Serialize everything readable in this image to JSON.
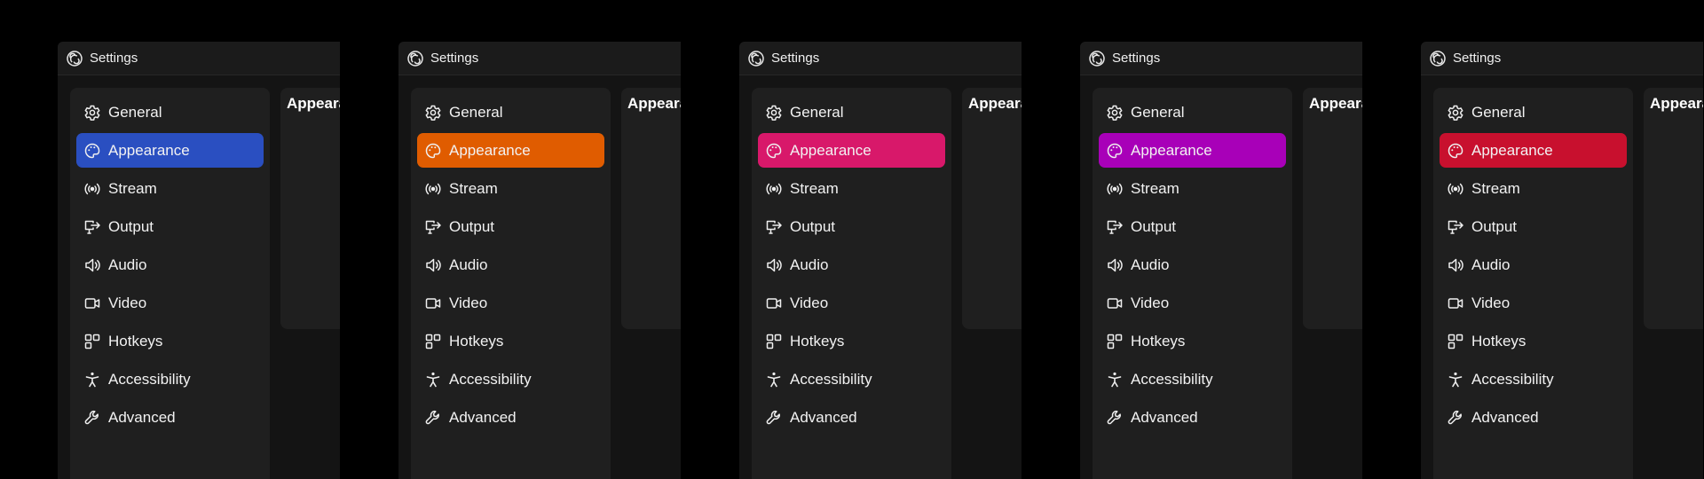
{
  "windows": [
    {
      "title": "Settings",
      "accent": "#2a4fc1",
      "nav": [
        {
          "label": "General",
          "icon": "gear-icon"
        },
        {
          "label": "Appearance",
          "icon": "palette-icon",
          "active": true
        },
        {
          "label": "Stream",
          "icon": "broadcast-icon"
        },
        {
          "label": "Output",
          "icon": "output-icon"
        },
        {
          "label": "Audio",
          "icon": "speaker-icon"
        },
        {
          "label": "Video",
          "icon": "video-camera-icon"
        },
        {
          "label": "Hotkeys",
          "icon": "hotkeys-icon"
        },
        {
          "label": "Accessibility",
          "icon": "accessibility-icon"
        },
        {
          "label": "Advanced",
          "icon": "wrench-icon"
        }
      ],
      "panel_title": "Appearance"
    },
    {
      "title": "Settings",
      "accent": "#e05c00",
      "nav": [
        {
          "label": "General",
          "icon": "gear-icon"
        },
        {
          "label": "Appearance",
          "icon": "palette-icon",
          "active": true
        },
        {
          "label": "Stream",
          "icon": "broadcast-icon"
        },
        {
          "label": "Output",
          "icon": "output-icon"
        },
        {
          "label": "Audio",
          "icon": "speaker-icon"
        },
        {
          "label": "Video",
          "icon": "video-camera-icon"
        },
        {
          "label": "Hotkeys",
          "icon": "hotkeys-icon"
        },
        {
          "label": "Accessibility",
          "icon": "accessibility-icon"
        },
        {
          "label": "Advanced",
          "icon": "wrench-icon"
        }
      ],
      "panel_title": "Appearance"
    },
    {
      "title": "Settings",
      "accent": "#d8186a",
      "nav": [
        {
          "label": "General",
          "icon": "gear-icon"
        },
        {
          "label": "Appearance",
          "icon": "palette-icon",
          "active": true
        },
        {
          "label": "Stream",
          "icon": "broadcast-icon"
        },
        {
          "label": "Output",
          "icon": "output-icon"
        },
        {
          "label": "Audio",
          "icon": "speaker-icon"
        },
        {
          "label": "Video",
          "icon": "video-camera-icon"
        },
        {
          "label": "Hotkeys",
          "icon": "hotkeys-icon"
        },
        {
          "label": "Accessibility",
          "icon": "accessibility-icon"
        },
        {
          "label": "Advanced",
          "icon": "wrench-icon"
        }
      ],
      "panel_title": "Appearance"
    },
    {
      "title": "Settings",
      "accent": "#a800b8",
      "nav": [
        {
          "label": "General",
          "icon": "gear-icon"
        },
        {
          "label": "Appearance",
          "icon": "palette-icon",
          "active": true
        },
        {
          "label": "Stream",
          "icon": "broadcast-icon"
        },
        {
          "label": "Output",
          "icon": "output-icon"
        },
        {
          "label": "Audio",
          "icon": "speaker-icon"
        },
        {
          "label": "Video",
          "icon": "video-camera-icon"
        },
        {
          "label": "Hotkeys",
          "icon": "hotkeys-icon"
        },
        {
          "label": "Accessibility",
          "icon": "accessibility-icon"
        },
        {
          "label": "Advanced",
          "icon": "wrench-icon"
        }
      ],
      "panel_title": "Appearance"
    },
    {
      "title": "Settings",
      "accent": "#c8102e",
      "nav": [
        {
          "label": "General",
          "icon": "gear-icon"
        },
        {
          "label": "Appearance",
          "icon": "palette-icon",
          "active": true
        },
        {
          "label": "Stream",
          "icon": "broadcast-icon"
        },
        {
          "label": "Output",
          "icon": "output-icon"
        },
        {
          "label": "Audio",
          "icon": "speaker-icon"
        },
        {
          "label": "Video",
          "icon": "video-camera-icon"
        },
        {
          "label": "Hotkeys",
          "icon": "hotkeys-icon"
        },
        {
          "label": "Accessibility",
          "icon": "accessibility-icon"
        },
        {
          "label": "Advanced",
          "icon": "wrench-icon"
        }
      ],
      "panel_title": "Appearance"
    }
  ]
}
